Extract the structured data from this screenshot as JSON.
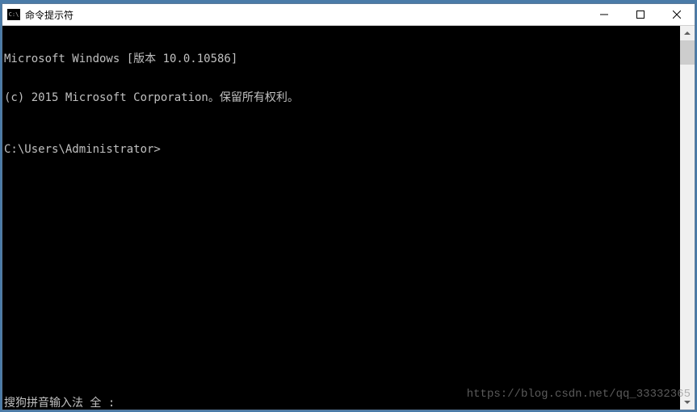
{
  "window": {
    "title": "命令提示符"
  },
  "console": {
    "line1": "Microsoft Windows [版本 10.0.10586]",
    "line2": "(c) 2015 Microsoft Corporation。保留所有权利。",
    "prompt": "C:\\Users\\Administrator>",
    "ime_status": "搜狗拼音输入法 全 :"
  },
  "watermark": "https://blog.csdn.net/qq_33332365"
}
